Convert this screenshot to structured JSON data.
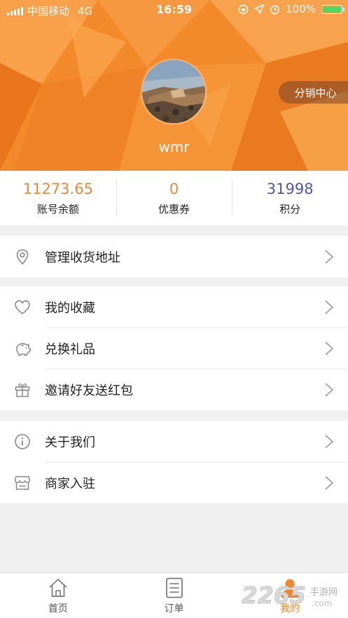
{
  "status_bar": {
    "carrier": "中国移动",
    "network": "4G",
    "time": "16:59",
    "battery": "100%",
    "battery_level": 1.0
  },
  "profile": {
    "username": "wmr",
    "distribution_button": "分销中心"
  },
  "stats": [
    {
      "value": "11273.65",
      "label": "账号余额",
      "color": "#e8893a"
    },
    {
      "value": "0",
      "label": "优惠券",
      "color": "#e8893a"
    },
    {
      "value": "31998",
      "label": "积分",
      "color": "#4e58a8"
    }
  ],
  "menu": {
    "address": {
      "label": "管理收货地址",
      "icon": "location-pin-icon"
    },
    "favorites": {
      "label": "我的收藏",
      "icon": "heart-icon"
    },
    "gifts": {
      "label": "兑换礼品",
      "icon": "piggy-bank-icon"
    },
    "invite": {
      "label": "邀请好友送红包",
      "icon": "gift-box-icon"
    },
    "about": {
      "label": "关于我们",
      "icon": "info-icon"
    },
    "merchant": {
      "label": "商家入驻",
      "icon": "store-icon"
    }
  },
  "tabbar": {
    "home": "首页",
    "orders": "订单",
    "mine": "我的",
    "active_color": "#f2862c"
  },
  "watermark": {
    "number": "2265",
    "text": "手游网",
    "domain": ".com"
  },
  "colors": {
    "header_orange": "#f28a2c",
    "accent": "#f2862c"
  }
}
